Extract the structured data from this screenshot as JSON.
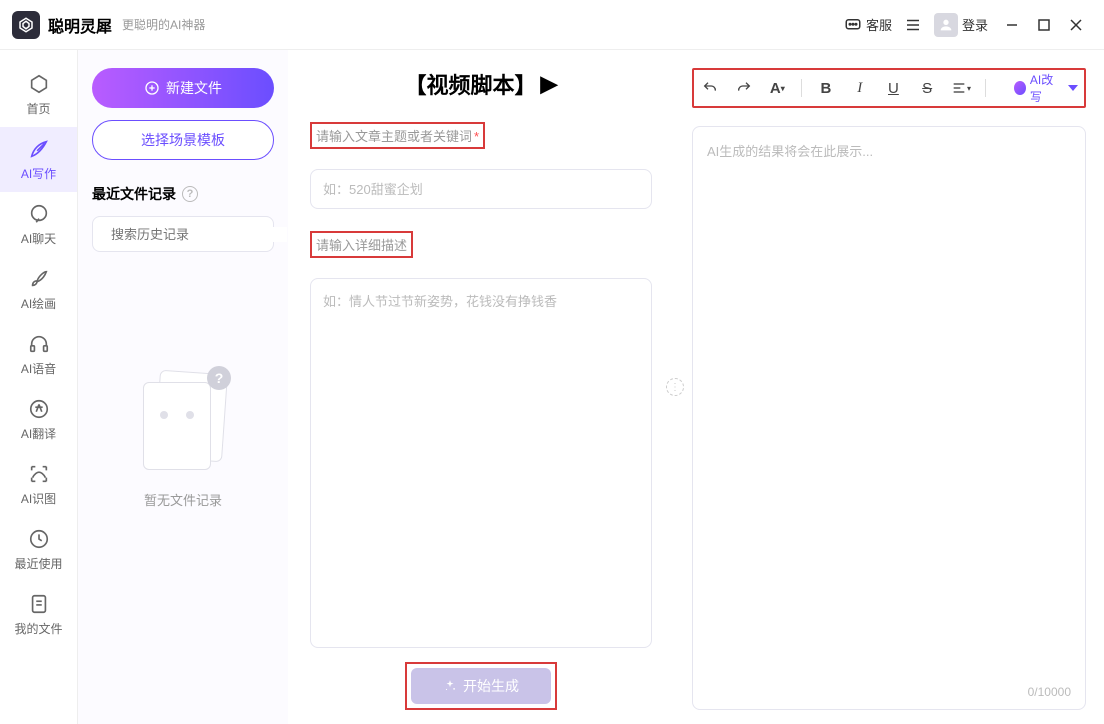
{
  "app": {
    "title": "聪明灵犀",
    "subtitle": "更聪明的AI神器"
  },
  "header": {
    "service": "客服",
    "login": "登录"
  },
  "rail": {
    "items": [
      {
        "label": "首页"
      },
      {
        "label": "AI写作"
      },
      {
        "label": "AI聊天"
      },
      {
        "label": "AI绘画"
      },
      {
        "label": "AI语音"
      },
      {
        "label": "AI翻译"
      },
      {
        "label": "AI识图"
      },
      {
        "label": "最近使用"
      },
      {
        "label": "我的文件"
      }
    ]
  },
  "filePanel": {
    "newFile": "新建文件",
    "template": "选择场景模板",
    "recentTitle": "最近文件记录",
    "searchPlaceholder": "搜索历史记录",
    "emptyText": "暂无文件记录"
  },
  "form": {
    "pageTitle": "【视频脚本】",
    "topicLabel": "请输入文章主题或者关键词",
    "topicPlaceholder": "如：520甜蜜企划",
    "descLabel": "请输入详细描述",
    "descPlaceholder": "如：情人节过节新姿势，花钱没有挣钱香",
    "generateBtn": "开始生成"
  },
  "output": {
    "placeholder": "AI生成的结果将会在此展示...",
    "counter": "0/10000",
    "rewriteLabel": "AI改写"
  }
}
